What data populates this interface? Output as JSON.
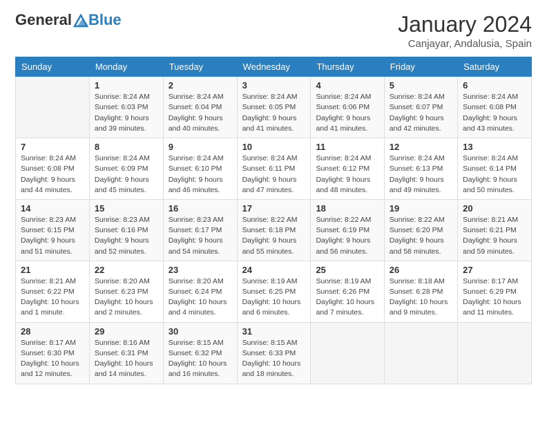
{
  "logo": {
    "general": "General",
    "blue": "Blue"
  },
  "title": "January 2024",
  "subtitle": "Canjayar, Andalusia, Spain",
  "days_of_week": [
    "Sunday",
    "Monday",
    "Tuesday",
    "Wednesday",
    "Thursday",
    "Friday",
    "Saturday"
  ],
  "weeks": [
    [
      {
        "num": "",
        "sunrise": "",
        "sunset": "",
        "daylight": ""
      },
      {
        "num": "1",
        "sunrise": "Sunrise: 8:24 AM",
        "sunset": "Sunset: 6:03 PM",
        "daylight": "Daylight: 9 hours and 39 minutes."
      },
      {
        "num": "2",
        "sunrise": "Sunrise: 8:24 AM",
        "sunset": "Sunset: 6:04 PM",
        "daylight": "Daylight: 9 hours and 40 minutes."
      },
      {
        "num": "3",
        "sunrise": "Sunrise: 8:24 AM",
        "sunset": "Sunset: 6:05 PM",
        "daylight": "Daylight: 9 hours and 41 minutes."
      },
      {
        "num": "4",
        "sunrise": "Sunrise: 8:24 AM",
        "sunset": "Sunset: 6:06 PM",
        "daylight": "Daylight: 9 hours and 41 minutes."
      },
      {
        "num": "5",
        "sunrise": "Sunrise: 8:24 AM",
        "sunset": "Sunset: 6:07 PM",
        "daylight": "Daylight: 9 hours and 42 minutes."
      },
      {
        "num": "6",
        "sunrise": "Sunrise: 8:24 AM",
        "sunset": "Sunset: 6:08 PM",
        "daylight": "Daylight: 9 hours and 43 minutes."
      }
    ],
    [
      {
        "num": "7",
        "sunrise": "Sunrise: 8:24 AM",
        "sunset": "Sunset: 6:08 PM",
        "daylight": "Daylight: 9 hours and 44 minutes."
      },
      {
        "num": "8",
        "sunrise": "Sunrise: 8:24 AM",
        "sunset": "Sunset: 6:09 PM",
        "daylight": "Daylight: 9 hours and 45 minutes."
      },
      {
        "num": "9",
        "sunrise": "Sunrise: 8:24 AM",
        "sunset": "Sunset: 6:10 PM",
        "daylight": "Daylight: 9 hours and 46 minutes."
      },
      {
        "num": "10",
        "sunrise": "Sunrise: 8:24 AM",
        "sunset": "Sunset: 6:11 PM",
        "daylight": "Daylight: 9 hours and 47 minutes."
      },
      {
        "num": "11",
        "sunrise": "Sunrise: 8:24 AM",
        "sunset": "Sunset: 6:12 PM",
        "daylight": "Daylight: 9 hours and 48 minutes."
      },
      {
        "num": "12",
        "sunrise": "Sunrise: 8:24 AM",
        "sunset": "Sunset: 6:13 PM",
        "daylight": "Daylight: 9 hours and 49 minutes."
      },
      {
        "num": "13",
        "sunrise": "Sunrise: 8:24 AM",
        "sunset": "Sunset: 6:14 PM",
        "daylight": "Daylight: 9 hours and 50 minutes."
      }
    ],
    [
      {
        "num": "14",
        "sunrise": "Sunrise: 8:23 AM",
        "sunset": "Sunset: 6:15 PM",
        "daylight": "Daylight: 9 hours and 51 minutes."
      },
      {
        "num": "15",
        "sunrise": "Sunrise: 8:23 AM",
        "sunset": "Sunset: 6:16 PM",
        "daylight": "Daylight: 9 hours and 52 minutes."
      },
      {
        "num": "16",
        "sunrise": "Sunrise: 8:23 AM",
        "sunset": "Sunset: 6:17 PM",
        "daylight": "Daylight: 9 hours and 54 minutes."
      },
      {
        "num": "17",
        "sunrise": "Sunrise: 8:22 AM",
        "sunset": "Sunset: 6:18 PM",
        "daylight": "Daylight: 9 hours and 55 minutes."
      },
      {
        "num": "18",
        "sunrise": "Sunrise: 8:22 AM",
        "sunset": "Sunset: 6:19 PM",
        "daylight": "Daylight: 9 hours and 56 minutes."
      },
      {
        "num": "19",
        "sunrise": "Sunrise: 8:22 AM",
        "sunset": "Sunset: 6:20 PM",
        "daylight": "Daylight: 9 hours and 58 minutes."
      },
      {
        "num": "20",
        "sunrise": "Sunrise: 8:21 AM",
        "sunset": "Sunset: 6:21 PM",
        "daylight": "Daylight: 9 hours and 59 minutes."
      }
    ],
    [
      {
        "num": "21",
        "sunrise": "Sunrise: 8:21 AM",
        "sunset": "Sunset: 6:22 PM",
        "daylight": "Daylight: 10 hours and 1 minute."
      },
      {
        "num": "22",
        "sunrise": "Sunrise: 8:20 AM",
        "sunset": "Sunset: 6:23 PM",
        "daylight": "Daylight: 10 hours and 2 minutes."
      },
      {
        "num": "23",
        "sunrise": "Sunrise: 8:20 AM",
        "sunset": "Sunset: 6:24 PM",
        "daylight": "Daylight: 10 hours and 4 minutes."
      },
      {
        "num": "24",
        "sunrise": "Sunrise: 8:19 AM",
        "sunset": "Sunset: 6:25 PM",
        "daylight": "Daylight: 10 hours and 6 minutes."
      },
      {
        "num": "25",
        "sunrise": "Sunrise: 8:19 AM",
        "sunset": "Sunset: 6:26 PM",
        "daylight": "Daylight: 10 hours and 7 minutes."
      },
      {
        "num": "26",
        "sunrise": "Sunrise: 8:18 AM",
        "sunset": "Sunset: 6:28 PM",
        "daylight": "Daylight: 10 hours and 9 minutes."
      },
      {
        "num": "27",
        "sunrise": "Sunrise: 8:17 AM",
        "sunset": "Sunset: 6:29 PM",
        "daylight": "Daylight: 10 hours and 11 minutes."
      }
    ],
    [
      {
        "num": "28",
        "sunrise": "Sunrise: 8:17 AM",
        "sunset": "Sunset: 6:30 PM",
        "daylight": "Daylight: 10 hours and 12 minutes."
      },
      {
        "num": "29",
        "sunrise": "Sunrise: 8:16 AM",
        "sunset": "Sunset: 6:31 PM",
        "daylight": "Daylight: 10 hours and 14 minutes."
      },
      {
        "num": "30",
        "sunrise": "Sunrise: 8:15 AM",
        "sunset": "Sunset: 6:32 PM",
        "daylight": "Daylight: 10 hours and 16 minutes."
      },
      {
        "num": "31",
        "sunrise": "Sunrise: 8:15 AM",
        "sunset": "Sunset: 6:33 PM",
        "daylight": "Daylight: 10 hours and 18 minutes."
      },
      {
        "num": "",
        "sunrise": "",
        "sunset": "",
        "daylight": ""
      },
      {
        "num": "",
        "sunrise": "",
        "sunset": "",
        "daylight": ""
      },
      {
        "num": "",
        "sunrise": "",
        "sunset": "",
        "daylight": ""
      }
    ]
  ]
}
